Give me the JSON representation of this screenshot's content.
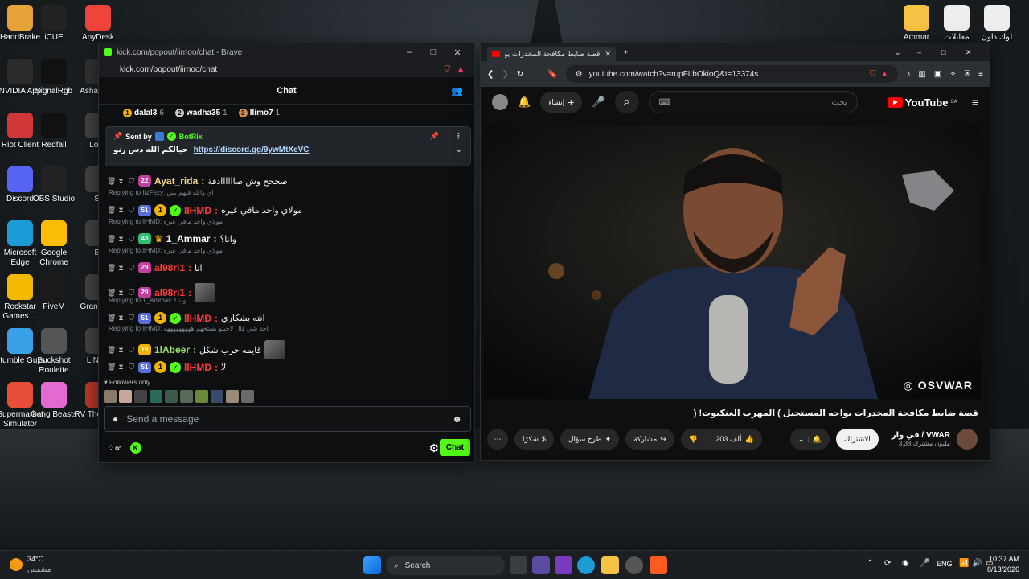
{
  "desktop": {
    "icons_left": [
      {
        "label": "HandBrake",
        "icon": "pineapple-icon",
        "color": "#e8a23a"
      },
      {
        "label": "iCUE",
        "icon": "icue-icon",
        "color": "#222"
      },
      {
        "label": "AnyDesk",
        "icon": "anydesk-icon",
        "color": "#ef443b"
      },
      {
        "label": "NVIDIA App",
        "icon": "nvidia-icon",
        "color": "#2b2b2b"
      },
      {
        "label": "SignalRgb",
        "icon": "signalrgb-icon",
        "color": "#111"
      },
      {
        "label": "Asha Auto",
        "icon": "generic-app-icon",
        "color": "#333"
      },
      {
        "label": "Riot Client",
        "icon": "riot-icon",
        "color": "#d13639"
      },
      {
        "label": "Redfall",
        "icon": "redfall-icon",
        "color": "#111"
      },
      {
        "label": "Loca",
        "icon": "generic-app-icon",
        "color": "#444"
      },
      {
        "label": "Discord",
        "icon": "discord-icon",
        "color": "#5865f2"
      },
      {
        "label": "OBS Studio",
        "icon": "obs-icon",
        "color": "#222"
      },
      {
        "label": "St",
        "icon": "generic-app-icon",
        "color": "#444"
      },
      {
        "label": "Microsoft Edge",
        "icon": "edge-icon",
        "color": "#1c9bd6"
      },
      {
        "label": "Google Chrome",
        "icon": "chrome-icon",
        "color": "#fbbc05"
      },
      {
        "label": "Bi",
        "icon": "generic-app-icon",
        "color": "#444"
      },
      {
        "label": "Rockstar Games ...",
        "icon": "rockstar-icon",
        "color": "#f5b800"
      },
      {
        "label": "FiveM",
        "icon": "fivem-icon",
        "color": "#1a1a1a"
      },
      {
        "label": "Gran Auto",
        "icon": "generic-app-icon",
        "color": "#444"
      },
      {
        "label": "Stumble Guys",
        "icon": "stumble-icon",
        "color": "#3aa0e8"
      },
      {
        "label": "Buckshot Roulette",
        "icon": "buckshot-icon",
        "color": "#555"
      },
      {
        "label": "L Nigh",
        "icon": "generic-app-icon",
        "color": "#444"
      },
      {
        "label": "Supermarket Simulator",
        "icon": "supermarket-icon",
        "color": "#e84d3a"
      },
      {
        "label": "Gang Beasts",
        "icon": "gangbeasts-icon",
        "color": "#e36bd0"
      },
      {
        "label": "RV There Yet",
        "icon": "rv-icon",
        "color": "#c0392b"
      }
    ],
    "icons_right": [
      {
        "label": "Ammar",
        "icon": "folder-icon",
        "color": "#f6c244"
      },
      {
        "label": "مقابلات",
        "icon": "video-file-icon",
        "color": "#eee"
      },
      {
        "label": "لوك داون",
        "icon": "video-file-icon",
        "color": "#eee"
      }
    ]
  },
  "kick": {
    "window_title": "kick.com/popout/iirnoo/chat - Brave",
    "url": "kick.com/popout/iirnoo/chat",
    "header": "Chat",
    "leaderboard": [
      {
        "rank": "1",
        "name": "dalal3",
        "count": "6",
        "color": "#f2b200"
      },
      {
        "rank": "2",
        "name": "wadha35",
        "count": "1",
        "color": "#c9c9c9"
      },
      {
        "rank": "3",
        "name": "llimo7",
        "count": "1",
        "color": "#d08a4a"
      }
    ],
    "pinned": {
      "sent_by": "Sent by",
      "author": "BotRix",
      "text": "حيالكم الله دس رنو",
      "link": "https://discord.gg/9ywMtXeVC"
    },
    "messages": [
      {
        "reply": "",
        "sub": "22",
        "sub_color": "#c23ea0",
        "level": "",
        "verified": false,
        "crown": false,
        "name": "Ayat_rida",
        "name_color": "#f5d38a",
        "text": "صححح وش صاااااادقة",
        "thumb": false
      },
      {
        "reply": "Replying to ItzFezy: اي والله فيهم بس",
        "sub": "51",
        "sub_color": "#5b6ee0",
        "level": "1",
        "verified": true,
        "crown": false,
        "name": "llHMD",
        "name_color": "#ff3b3b",
        "text": "مولاي واحد مافي غيره",
        "thumb": false
      },
      {
        "reply": "Replying to llHMD: مولاي واحد مافي غيره",
        "sub": "43",
        "sub_color": "#2fbf71",
        "level": "",
        "verified": false,
        "crown": true,
        "name": "1_Ammar",
        "name_color": "#ffffff",
        "text": "وانا؟",
        "thumb": false
      },
      {
        "reply": "Replying to llHMD: مولاي واحد مافي غيره",
        "sub": "29",
        "sub_color": "#c23ea0",
        "level": "",
        "verified": false,
        "crown": false,
        "name": "al98ri1",
        "name_color": "#ff3b3b",
        "text": "انا",
        "thumb": false
      },
      {
        "reply": "",
        "sub": "29",
        "sub_color": "#c23ea0",
        "level": "",
        "verified": false,
        "crown": false,
        "name": "al98ri1",
        "name_color": "#ff3b3b",
        "text": "",
        "thumb": true
      },
      {
        "reply": "Replying to 1_Ammar: وانا؟",
        "sub": "51",
        "sub_color": "#5b6ee0",
        "level": "1",
        "verified": true,
        "crown": false,
        "name": "llHMD",
        "name_color": "#ff3b3b",
        "text": "انته بشكاري",
        "thumb": false
      },
      {
        "reply": "Replying to llHMD: احد شي فال لاحبتو يستحهم هههههههههه",
        "sub": "19",
        "sub_color": "#f2b200",
        "level": "",
        "verified": false,
        "crown": false,
        "name": "1lAbeer",
        "name_color": "#9ee06a",
        "text": "قايمه حرب شكل",
        "thumb": true
      },
      {
        "reply": "",
        "sub": "51",
        "sub_color": "#5b6ee0",
        "level": "1",
        "verified": true,
        "crown": false,
        "name": "llHMD",
        "name_color": "#ff3b3b",
        "text": "لا",
        "thumb": false
      }
    ],
    "followers_only": "Followers only",
    "input_placeholder": "Send a message",
    "chat_button": "Chat",
    "accent": "#53fc18"
  },
  "youtube": {
    "tab_title": "قصة ضابط مكافحة المخدرات يواجه",
    "url": "youtube.com/watch?v=rupFLbOkioQ&t=13374s",
    "create_label": "إنشاء",
    "search_placeholder": "بحث",
    "logo_text": "YouTube",
    "logo_region": "SA",
    "watermark": "OSVWAR",
    "video_title": "قصة ضابط مكافحة المخدرات يواجه المستحيل ) المهرب العنكبوت! (",
    "channel_name": "في وار / VWAR",
    "subscribers": "3.38 مليون مشترك",
    "subscribe_label": "الاشتراك",
    "like_count": "203 ألف",
    "share_label": "مشاركة",
    "ask_label": "طرح سؤال",
    "thanks_label": "شكرًا"
  },
  "taskbar": {
    "weather_temp": "34°C",
    "weather_desc": "مشمس",
    "search_label": "Search",
    "language": "ENG",
    "time": "10:37 AM",
    "date": "8/13/2026"
  }
}
